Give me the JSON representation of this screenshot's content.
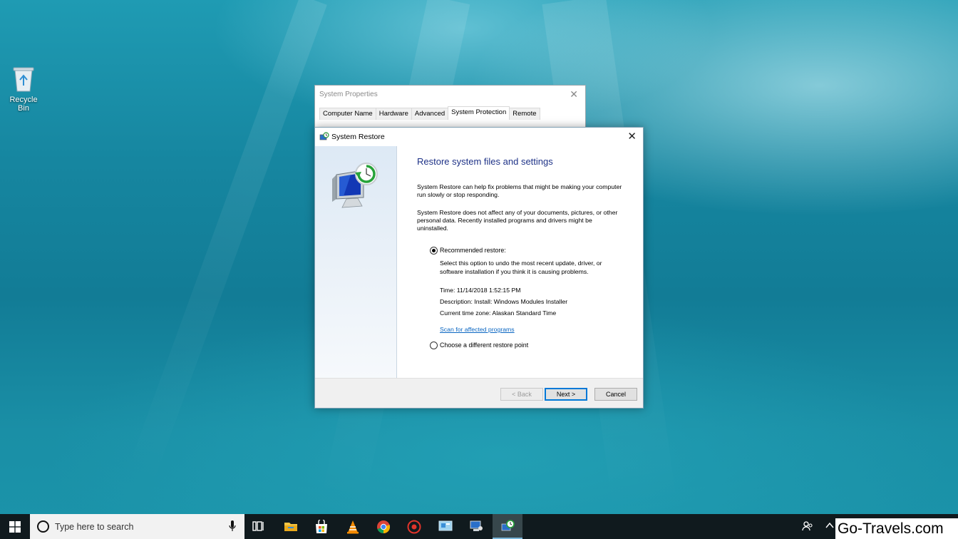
{
  "desktop": {
    "recycle_bin_label": "Recycle Bin"
  },
  "system_properties": {
    "title": "System Properties",
    "tabs": [
      "Computer Name",
      "Hardware",
      "Advanced",
      "System Protection",
      "Remote"
    ],
    "active_tab": "System Protection"
  },
  "system_restore": {
    "title": "System Restore",
    "heading": "Restore system files and settings",
    "paragraph1": "System Restore can help fix problems that might be making your computer run slowly or stop responding.",
    "paragraph2": "System Restore does not affect any of your documents, pictures, or other personal data. Recently installed programs and drivers might be uninstalled.",
    "recommended_label": "Recommended restore:",
    "recommended_selected": true,
    "recommended_desc": "Select this option to undo the most recent update, driver, or software installation if you think it is causing problems.",
    "time_line": "Time: 11/14/2018 1:52:15 PM",
    "description_line": "Description: Install: Windows Modules Installer",
    "timezone_line": "Current time zone: Alaskan Standard Time",
    "scan_link": "Scan for affected programs",
    "different_label": "Choose a different restore point",
    "buttons": {
      "back": "< Back",
      "next": "Next >",
      "cancel": "Cancel"
    }
  },
  "taskbar": {
    "search_placeholder": "Type here to search",
    "icons": [
      "windows-start-icon",
      "task-view-icon",
      "file-explorer-icon",
      "store-icon",
      "vlc-icon",
      "chrome-icon",
      "app-red-icon",
      "control-panel-icon",
      "system-icon",
      "system-restore-icon"
    ],
    "watermark": "Go-Travels.com"
  }
}
